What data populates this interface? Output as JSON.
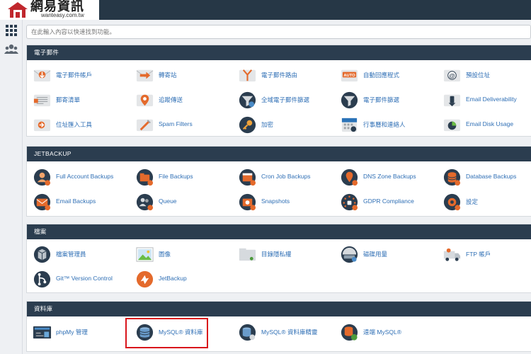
{
  "brand": {
    "title": "網易資訊",
    "subtitle": "wanteasy.com.tw",
    "house_icon": "house-logo-icon",
    "colors": {
      "header": "#263746",
      "panel_header": "#2b3d4f",
      "link": "#2f6fb5",
      "highlight": "#d9141b"
    }
  },
  "sidebar": {
    "items": [
      {
        "icon": "grid-icon"
      },
      {
        "icon": "users-icon"
      }
    ]
  },
  "search": {
    "placeholder": "在此輸入內容以快速找到功能。"
  },
  "sections": [
    {
      "title": "電子郵件",
      "items": [
        {
          "label": "電子郵件帳戶",
          "icon": "email-accounts-icon"
        },
        {
          "label": "轉寄站",
          "icon": "forwarders-icon"
        },
        {
          "label": "電子郵件路由",
          "icon": "email-routing-icon"
        },
        {
          "label": "自動回應程式",
          "icon": "autoresponders-icon"
        },
        {
          "label": "預設位址",
          "icon": "default-address-icon"
        },
        {
          "label": "郵寄清單",
          "icon": "mailing-lists-icon"
        },
        {
          "label": "追蹤傳送",
          "icon": "track-delivery-icon"
        },
        {
          "label": "全域電子郵件篩選",
          "icon": "global-email-filters-icon"
        },
        {
          "label": "電子郵件篩選",
          "icon": "email-filters-icon"
        },
        {
          "label": "Email Deliverability",
          "icon": "email-deliverability-icon"
        },
        {
          "label": "位址匯入工具",
          "icon": "address-importer-icon"
        },
        {
          "label": "Spam Filters",
          "icon": "spam-filters-icon"
        },
        {
          "label": "加密",
          "icon": "encryption-icon"
        },
        {
          "label": "行事曆和連絡人",
          "icon": "calendars-contacts-icon"
        },
        {
          "label": "Email Disk Usage",
          "icon": "email-disk-usage-icon"
        }
      ]
    },
    {
      "title": "JETBACKUP",
      "items": [
        {
          "label": "Full Account Backups",
          "icon": "full-account-backups-icon"
        },
        {
          "label": "File Backups",
          "icon": "file-backups-icon"
        },
        {
          "label": "Cron Job Backups",
          "icon": "cron-job-backups-icon"
        },
        {
          "label": "DNS Zone Backups",
          "icon": "dns-zone-backups-icon"
        },
        {
          "label": "Database Backups",
          "icon": "database-backups-icon"
        },
        {
          "label": "Email Backups",
          "icon": "email-backups-icon"
        },
        {
          "label": "Queue",
          "icon": "queue-icon"
        },
        {
          "label": "Snapshots",
          "icon": "snapshots-icon"
        },
        {
          "label": "GDPR Compliance",
          "icon": "gdpr-compliance-icon"
        },
        {
          "label": "設定",
          "icon": "settings-icon"
        }
      ]
    },
    {
      "title": "檔案",
      "items": [
        {
          "label": "檔案管理員",
          "icon": "file-manager-icon"
        },
        {
          "label": "圖像",
          "icon": "images-icon"
        },
        {
          "label": "目錄隱私權",
          "icon": "directory-privacy-icon"
        },
        {
          "label": "磁碟用量",
          "icon": "disk-usage-icon"
        },
        {
          "label": "FTP 帳戶",
          "icon": "ftp-accounts-icon"
        },
        {
          "label": "Git™ Version Control",
          "icon": "git-version-control-icon"
        },
        {
          "label": "JetBackup",
          "icon": "jetbackup-icon"
        }
      ]
    },
    {
      "title": "資料庫",
      "items": [
        {
          "label": "phpMy 管理",
          "icon": "phpmyadmin-icon"
        },
        {
          "label": "MySQL® 資料庫",
          "icon": "mysql-databases-icon"
        },
        {
          "label": "MySQL® 資料庫精靈",
          "icon": "mysql-database-wizard-icon"
        },
        {
          "label": "遠端 MySQL®",
          "icon": "remote-mysql-icon"
        }
      ]
    }
  ]
}
